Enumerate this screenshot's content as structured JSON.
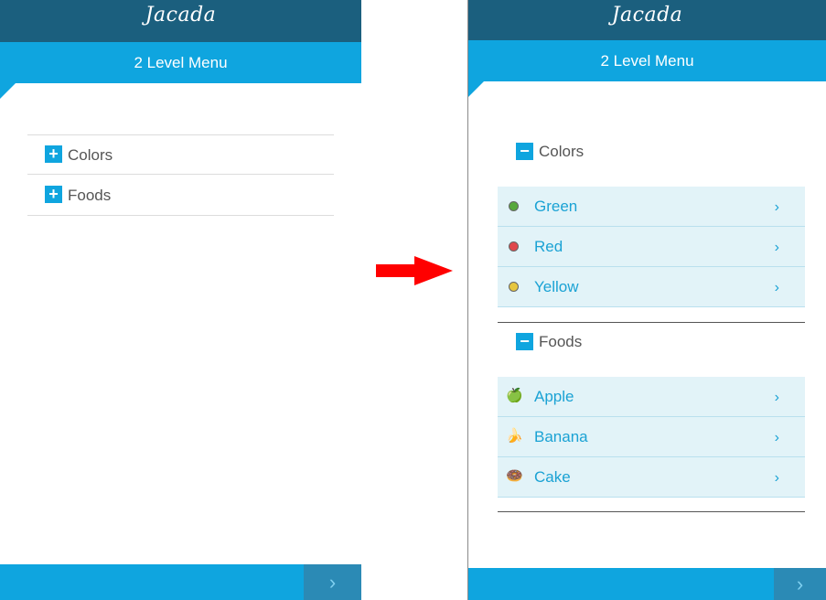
{
  "logo_text": "Jacada",
  "title": "2 Level Menu",
  "arrow_color": "#ff0000",
  "next_icon": "chevron-right-icon",
  "left_screen": {
    "items": [
      {
        "toggle": "+",
        "label": "Colors"
      },
      {
        "toggle": "+",
        "label": "Foods"
      }
    ]
  },
  "right_screen": {
    "colors": {
      "toggle": "−",
      "label": "Colors",
      "items": [
        {
          "label": "Green",
          "icon": "green-dot-icon",
          "color": "#57a83c"
        },
        {
          "label": "Red",
          "icon": "red-dot-icon",
          "color": "#e0474c"
        },
        {
          "label": "Yellow",
          "icon": "yellow-dot-icon",
          "color": "#e6c640"
        }
      ]
    },
    "foods": {
      "toggle": "−",
      "label": "Foods",
      "items": [
        {
          "label": "Apple",
          "icon": "apple-icon",
          "glyph": "🍏"
        },
        {
          "label": "Banana",
          "icon": "banana-icon",
          "glyph": "🍌"
        },
        {
          "label": "Cake",
          "icon": "cake-icon",
          "glyph": "🍩"
        }
      ]
    }
  },
  "chevron": "›"
}
